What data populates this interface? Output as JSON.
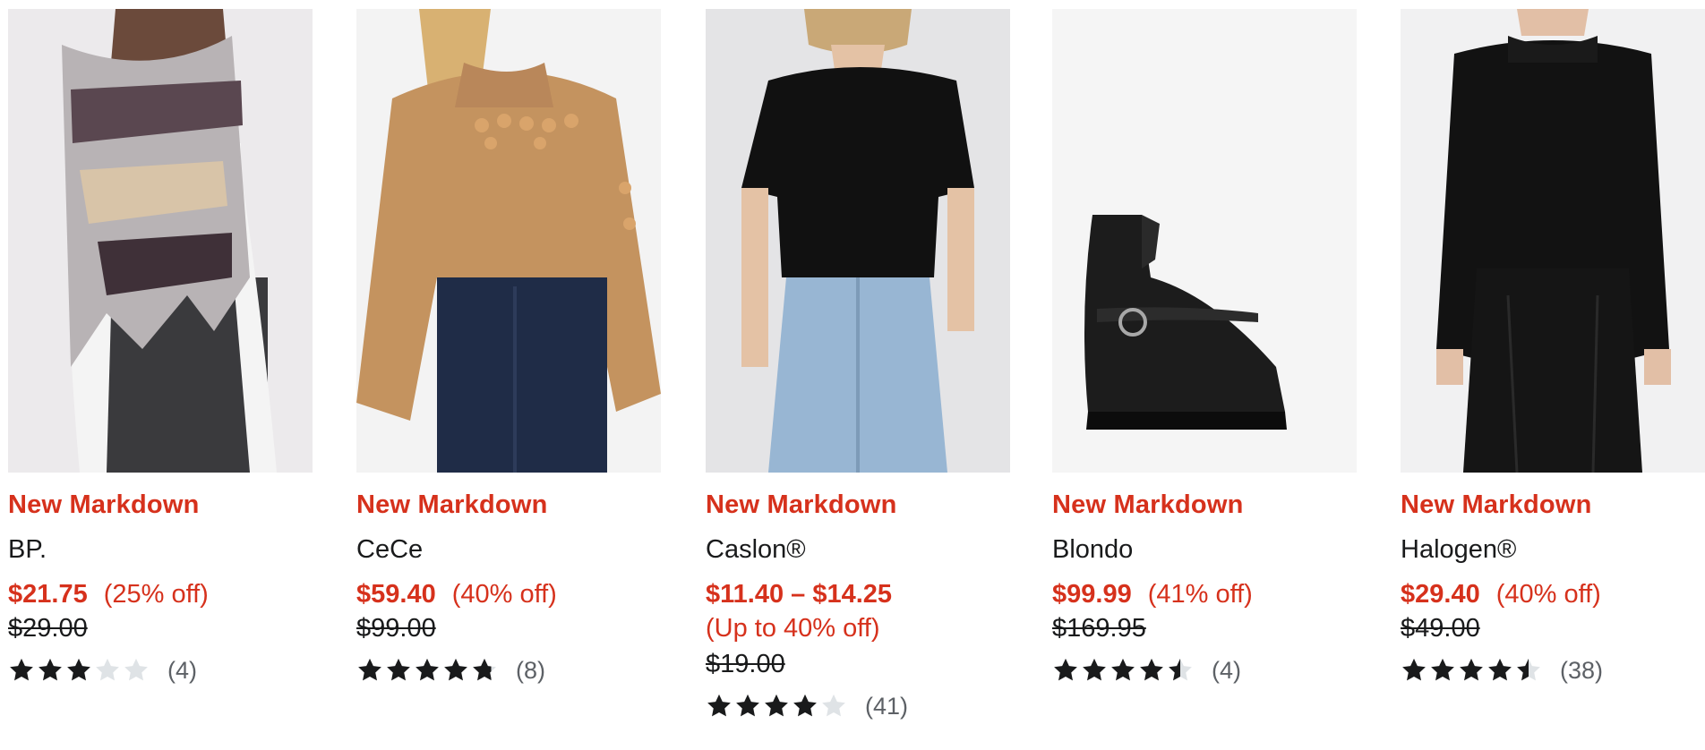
{
  "products": [
    {
      "badge": "New Markdown",
      "brand": "BP.",
      "price": "$21.75",
      "percent": "(25% off)",
      "original": "$29.00",
      "rating": 3,
      "review_count": "(4)",
      "image": "woman-in-plaid-scarf",
      "image_bg": "#eceaec"
    },
    {
      "badge": "New Markdown",
      "brand": "CeCe",
      "price": "$59.40",
      "percent": "(40% off)",
      "original": "$99.00",
      "rating": 4.8,
      "review_count": "(8)",
      "image": "woman-in-camel-floral-sweater",
      "image_bg": "#f3f3f3"
    },
    {
      "badge": "New Markdown",
      "brand": "Caslon®",
      "price": "$11.40 – $14.25",
      "percent": "(Up to 40% off)",
      "original": "$19.00",
      "rating": 4,
      "review_count": "(41)",
      "image": "woman-in-black-tee-and-jeans",
      "image_bg": "#e4e4e6"
    },
    {
      "badge": "New Markdown",
      "brand": "Blondo",
      "price": "$99.99",
      "percent": "(41% off)",
      "original": "$169.95",
      "rating": 4.5,
      "review_count": "(4)",
      "image": "black-leather-ankle-boot",
      "image_bg": "#f5f5f5"
    },
    {
      "badge": "New Markdown",
      "brand": "Halogen®",
      "price": "$29.40",
      "percent": "(40% off)",
      "original": "$49.00",
      "rating": 4.5,
      "review_count": "(38)",
      "image": "woman-in-black-sweater-and-leather-pants",
      "image_bg": "#f1f1f2"
    }
  ],
  "colors": {
    "sale_red": "#d6311c",
    "text": "#191a1b",
    "muted": "#5d6166",
    "star_fill": "#191a1b",
    "star_empty": "#dfe3e6"
  }
}
